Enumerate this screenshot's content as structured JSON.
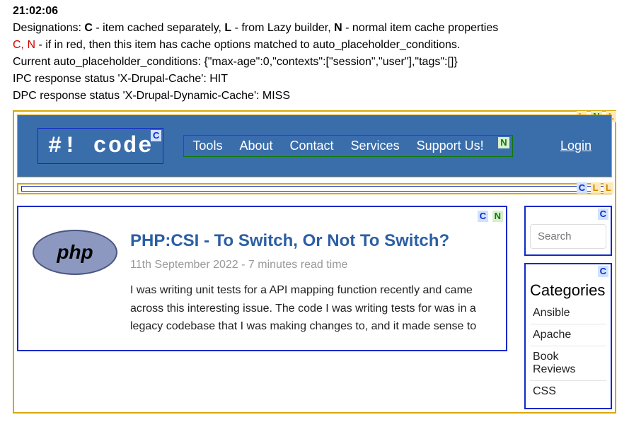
{
  "info": {
    "time": "21:02:06",
    "designations_prefix": "Designations: ",
    "designations_C": "C",
    "designations_C_text": " - item cached separately, ",
    "designations_L": "L",
    "designations_L_text": " - from Lazy builder, ",
    "designations_N": "N",
    "designations_N_text": " - normal item cache properties",
    "red_prefix": "C, N",
    "red_text": " - if in red, then this item has cache options matched to auto_placeholder_conditions.",
    "conditions_label": "Current auto_placeholder_conditions: ",
    "conditions_value": "{\"max-age\":0,\"contexts\":[\"session\",\"user\"],\"tags\":[]}",
    "ipc": "IPC response status 'X-Drupal-Cache': HIT",
    "dpc": "DPC response status 'X-Drupal-Dynamic-Cache': MISS"
  },
  "badges": {
    "C": "C",
    "N": "N",
    "L": "L"
  },
  "header": {
    "logo": "#! code",
    "nav": [
      "Tools",
      "About",
      "Contact",
      "Services",
      "Support Us!"
    ],
    "login": "Login"
  },
  "search": {
    "placeholder": "Search"
  },
  "categories": {
    "title": "Categories",
    "items": [
      "Ansible",
      "Apache",
      "Book Reviews",
      "CSS"
    ]
  },
  "article": {
    "php": "php",
    "title": "PHP:CSI - To Switch, Or Not To Switch?",
    "meta": "11th September 2022 - 7 minutes read time",
    "excerpt": "I was writing unit tests for a API mapping function recently and came across this interesting issue. The code I was writing tests for was in a legacy codebase that I was making changes to, and it made sense to"
  }
}
